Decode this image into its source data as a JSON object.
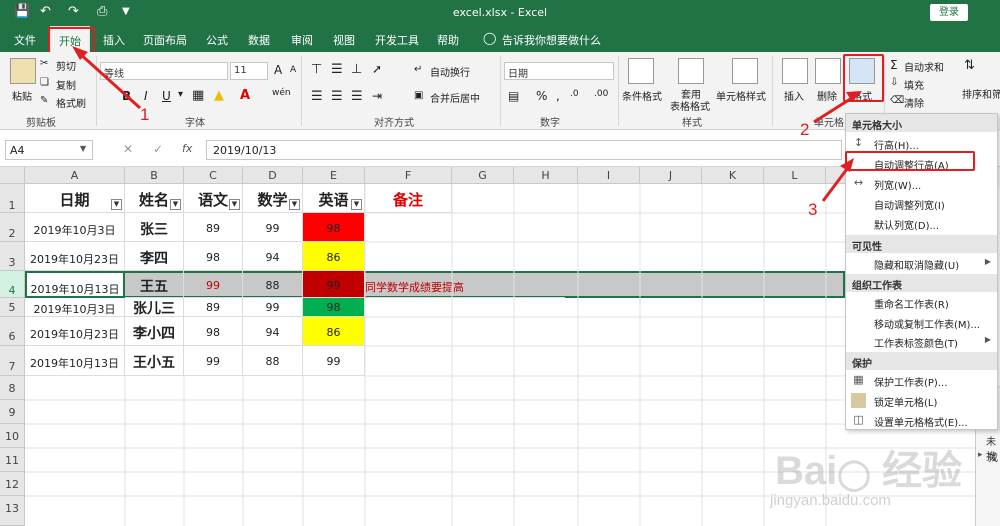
{
  "titlebar": {
    "title": "excel.xlsx  -  Excel",
    "login": "登录",
    "save_icon": "save-icon",
    "undo_icon": "undo-icon",
    "redo_icon": "redo-icon",
    "preview_icon": "print-preview-icon"
  },
  "tabs": [
    "文件",
    "开始",
    "插入",
    "页面布局",
    "公式",
    "数据",
    "审阅",
    "视图",
    "开发工具",
    "帮助"
  ],
  "tell_me": "告诉我你想要做什么",
  "ribbon": {
    "clipboard": {
      "paste": "粘贴",
      "cut": "剪切",
      "copy": "复制",
      "format_painter": "格式刷",
      "label": "剪贴板"
    },
    "font": {
      "name": "等线",
      "size": "11",
      "label": "字体",
      "bold": "B",
      "italic": "I",
      "underline": "U",
      "grow": "A",
      "shrink": "A",
      "wen": "wén"
    },
    "alignment": {
      "wrap": "自动换行",
      "merge": "合并后居中",
      "label": "对齐方式"
    },
    "number": {
      "format": "日期",
      "percent": "%",
      "comma": ",",
      "label": "数字"
    },
    "styles": {
      "conditional": "条件格式",
      "table1": "套用",
      "table2": "表格格式",
      "cell_styles": "单元格样式",
      "label": "样式"
    },
    "cells": {
      "insert": "插入",
      "delete": "删除",
      "format": "格式",
      "label": "单元格"
    },
    "editing": {
      "autosum": "自动求和",
      "fill": "填充",
      "clear": "清除",
      "sort": "排序和筛"
    }
  },
  "formula_bar": {
    "name_box": "A4",
    "cancel": "✕",
    "enter": "✓",
    "fx": "fx",
    "value": "2019/10/13"
  },
  "columns": [
    "A",
    "B",
    "C",
    "D",
    "E",
    "F",
    "G",
    "H",
    "I",
    "J",
    "K",
    "L"
  ],
  "rows": [
    "1",
    "2",
    "3",
    "4",
    "5",
    "6",
    "7",
    "8",
    "9",
    "10",
    "11",
    "12",
    "13"
  ],
  "header_row": [
    "日期",
    "姓名",
    "语文",
    "数学",
    "英语",
    "备注"
  ],
  "table": [
    {
      "date": "2019年10月3日",
      "name": "张三",
      "chinese": "89",
      "math": "99",
      "english": "98",
      "note": ""
    },
    {
      "date": "2019年10月23日",
      "name": "李四",
      "chinese": "98",
      "math": "94",
      "english": "86",
      "note": ""
    },
    {
      "date": "2019年10月13日",
      "name": "王五",
      "chinese": "99",
      "math": "88",
      "english": "99",
      "note": "同学数学成绩要提高"
    },
    {
      "date": "2019年10月3日",
      "name": "张儿三",
      "chinese": "89",
      "math": "99",
      "english": "98",
      "note": ""
    },
    {
      "date": "2019年10月23日",
      "name": "李小四",
      "chinese": "98",
      "math": "94",
      "english": "86",
      "note": ""
    },
    {
      "date": "2019年10月13日",
      "name": "王小五",
      "chinese": "99",
      "math": "88",
      "english": "99",
      "note": ""
    }
  ],
  "colors": {
    "green": "#217346",
    "red_fill": "#ff0000",
    "dark_red_fill": "#c00000",
    "yellow_fill": "#ffff00",
    "green_fill": "#00b050",
    "annot_red": "#e02020"
  },
  "menu": {
    "sec_size": "单元格大小",
    "row_height": "行高(H)...",
    "autofit_row": "自动调整行高(A)",
    "col_width": "列宽(W)...",
    "autofit_col": "自动调整列宽(I)",
    "default_width": "默认列宽(D)...",
    "sec_visibility": "可见性",
    "hide_unhide": "隐藏和取消隐藏(U)",
    "sec_organize": "组织工作表",
    "rename": "重命名工作表(R)",
    "move_copy": "移动或复制工作表(M)...",
    "tab_color": "工作表标签颜色(T)",
    "sec_protect": "保护",
    "protect_sheet": "保护工作表(P)...",
    "lock_cell": "锁定单元格(L)",
    "format_cells": "设置单元格格式(E)..."
  },
  "annotations": [
    "1",
    "2",
    "3"
  ],
  "right_pane": {
    "item1": "未找",
    "item2": "找"
  },
  "watermark": {
    "logo": "Bai 经验",
    "url": "jingyan.baidu.com"
  }
}
